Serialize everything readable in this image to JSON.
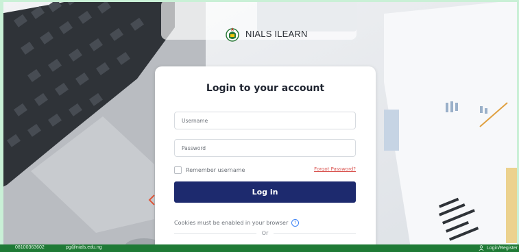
{
  "brand": {
    "name": "NIALS ILEARN",
    "icon": "nials-logo-icon"
  },
  "login": {
    "title": "Login to your account",
    "username_placeholder": "Username",
    "password_placeholder": "Password",
    "remember_label": "Remember username",
    "remember_checked": false,
    "forgot_label": "Forgot Password?",
    "login_button": "Log in",
    "cookies_notice": "Cookies must be enabled in your browser",
    "help_icon": "help-circle-icon",
    "or_label": "Or"
  },
  "footer": {
    "phone": "08100363602",
    "email": "pg@nials.edu.ng",
    "login_register": "Login/Register",
    "user_icon": "user-icon"
  },
  "colors": {
    "primary": "#1d2a6e",
    "footer_bg": "#1f7a36",
    "link": "#d9534f",
    "card_bg": "#ffffff"
  }
}
